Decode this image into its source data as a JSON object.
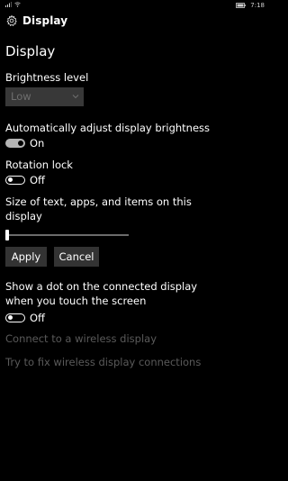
{
  "status_bar": {
    "time": "7:18"
  },
  "header": {
    "title": "Display"
  },
  "page": {
    "title": "Display"
  },
  "brightness": {
    "label": "Brightness level",
    "selected": "Low"
  },
  "auto_brightness": {
    "label": "Automatically adjust display brightness",
    "state": "On"
  },
  "rotation_lock": {
    "label": "Rotation lock",
    "state": "Off"
  },
  "text_size": {
    "label": "Size of text, apps, and items on this display",
    "level": 0
  },
  "buttons": {
    "apply": "Apply",
    "cancel": "Cancel"
  },
  "touch_dot": {
    "label": "Show a dot on the connected display when you touch the screen",
    "state": "Off"
  },
  "links": {
    "connect_wireless": "Connect to a wireless display",
    "fix_wireless": "Try to fix wireless display connections"
  },
  "colors": {
    "background": "#000000",
    "text": "#ffffff",
    "disabled": "#5a5a5a",
    "button_bg": "#333333",
    "dropdown_bg": "#383838"
  }
}
